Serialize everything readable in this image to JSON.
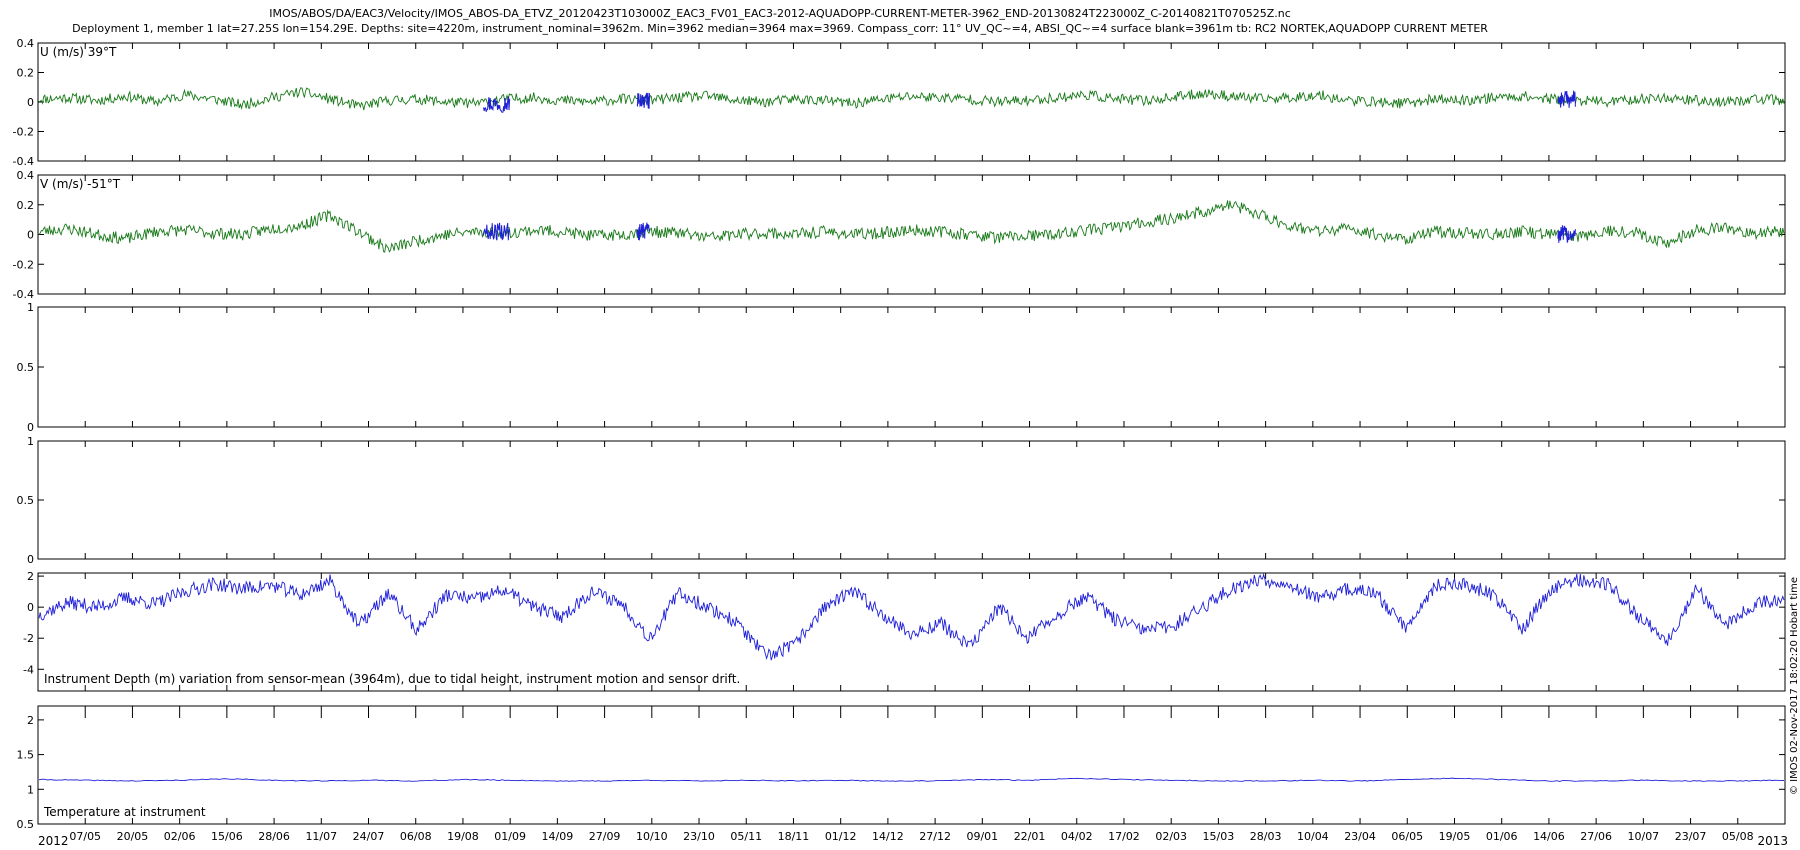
{
  "header": {
    "title_line1": "IMOS/ABOS/DA/EAC3/Velocity/IMOS_ABOS-DA_ETVZ_20120423T103000Z_EAC3_FV01_EAC3-2012-AQUADOPP-CURRENT-METER-3962_END-20130824T223000Z_C-20140821T070525Z.nc",
    "title_line2": "Deployment 1, member 1 lat=27.25S lon=154.29E. Depths: site=4220m, instrument_nominal=3962m. Min=3962 median=3964 max=3969. Compass_corr: 11° UV_QC~=4, ABSI_QC~=4 surface blank=3961m tb: RC2 NORTEK,AQUADOPP CURRENT METER"
  },
  "side_note": "© IMOS 02-Nov-2017 18:02:20 Hobart time",
  "time_axis": {
    "start_year_label": "2012",
    "end_year_label": "2013",
    "ticks": [
      "07/05",
      "20/05",
      "02/06",
      "15/06",
      "28/06",
      "11/07",
      "24/07",
      "06/08",
      "19/08",
      "01/09",
      "14/09",
      "27/09",
      "10/10",
      "23/10",
      "05/11",
      "18/11",
      "01/12",
      "14/12",
      "27/12",
      "09/01",
      "22/01",
      "04/02",
      "17/02",
      "02/03",
      "15/03",
      "28/03",
      "10/04",
      "23/04",
      "06/05",
      "19/05",
      "01/06",
      "14/06",
      "27/06",
      "10/07",
      "23/07",
      "05/08"
    ]
  },
  "colors": {
    "velocity_qc_good": "#1a7a1a",
    "velocity_qc_flagged": "#1f1fd8",
    "depth": "#1f1fd8",
    "temperature": "#1f1fd8",
    "axes": "#000000"
  },
  "chart_data": [
    {
      "id": "u",
      "type": "line",
      "title": "U (m/s) 39°T",
      "xlabel": "",
      "ylabel": "",
      "ylim": [
        -0.4,
        0.4
      ],
      "yticks": [
        "0.4",
        "0.2",
        "0",
        "-0.2",
        "-0.4"
      ],
      "yvals": [
        0.4,
        0.2,
        0,
        -0.2,
        -0.4
      ],
      "grid": false,
      "series": [
        {
          "values": [
            0.02,
            0.03,
            0.01,
            0.04,
            0.0,
            0.05,
            0.02,
            -0.02,
            0.03,
            0.07,
            0.02,
            -0.03,
            0.01,
            0.02,
            0.0,
            -0.01,
            0.02,
            0.03,
            0.01,
            0.0,
            0.02,
            0.01,
            0.03,
            0.04,
            0.01,
            0.0,
            0.02,
            0.01,
            -0.01,
            0.02,
            0.04,
            0.03,
            0.02,
            0.0,
            0.01,
            0.03,
            0.05,
            0.02,
            0.01,
            0.03,
            0.06,
            0.04,
            0.02,
            0.03,
            0.05,
            0.01,
            0.0,
            -0.01,
            0.02,
            0.01,
            0.03,
            0.04,
            0.02,
            0.01,
            0.0,
            0.02,
            0.03,
            0.01,
            0.0,
            0.02,
            0.01
          ]
        }
      ]
    },
    {
      "id": "v",
      "type": "line",
      "title": "V (m/s) -51°T",
      "xlabel": "",
      "ylabel": "",
      "ylim": [
        -0.4,
        0.4
      ],
      "yticks": [
        "0.4",
        "0.2",
        "0",
        "-0.2",
        "-0.4"
      ],
      "yvals": [
        0.4,
        0.2,
        0,
        -0.2,
        -0.4
      ],
      "grid": false,
      "series": [
        {
          "values": [
            0.02,
            0.04,
            0.0,
            -0.03,
            0.02,
            0.03,
            0.01,
            0.0,
            0.04,
            0.06,
            0.13,
            0.02,
            -0.1,
            -0.04,
            0.0,
            0.02,
            0.01,
            0.03,
            0.02,
            -0.01,
            0.0,
            0.02,
            0.01,
            -0.02,
            0.0,
            0.01,
            0.0,
            0.02,
            0.0,
            0.01,
            0.03,
            0.02,
            0.0,
            -0.02,
            -0.01,
            0.0,
            0.03,
            0.05,
            0.08,
            0.11,
            0.15,
            0.2,
            0.13,
            0.06,
            0.02,
            0.04,
            0.0,
            -0.03,
            0.02,
            0.01,
            0.0,
            0.02,
            0.0,
            -0.01,
            0.03,
            0.01,
            -0.06,
            0.03,
            0.04,
            0.01,
            0.02
          ]
        }
      ]
    },
    {
      "id": "empty1",
      "type": "line",
      "title": "",
      "xlabel": "",
      "ylabel": "",
      "ylim": [
        0,
        1
      ],
      "yticks": [
        "1",
        "0.5",
        "0"
      ],
      "yvals": [
        1,
        0.5,
        0
      ],
      "grid": false,
      "series": []
    },
    {
      "id": "empty2",
      "type": "line",
      "title": "",
      "xlabel": "",
      "ylabel": "",
      "ylim": [
        0,
        1
      ],
      "yticks": [
        "1",
        "0.5",
        "0"
      ],
      "yvals": [
        1,
        0.5,
        0
      ],
      "grid": false,
      "series": []
    },
    {
      "id": "depth",
      "type": "line",
      "title": "",
      "annotation": "Instrument Depth (m) variation from sensor-mean (3964m), due to tidal height, instrument motion and sensor drift.",
      "xlabel": "",
      "ylabel": "",
      "ylim": [
        -5.4,
        2.2
      ],
      "yticks": [
        "2",
        "0",
        "-2",
        "-4"
      ],
      "yvals": [
        2,
        0,
        -2,
        -4
      ],
      "grid": false,
      "series": [
        {
          "values": [
            -0.5,
            0.3,
            0.0,
            0.6,
            0.2,
            1.0,
            1.5,
            1.2,
            1.4,
            0.8,
            1.7,
            -1.2,
            0.9,
            -1.5,
            0.8,
            0.5,
            1.1,
            0.0,
            -0.6,
            1.0,
            0.3,
            -2.0,
            0.9,
            0.0,
            -1.0,
            -3.2,
            -2.4,
            0.0,
            1.0,
            -0.4,
            -1.8,
            -1.0,
            -2.6,
            0.0,
            -2.0,
            -0.5,
            0.7,
            -0.8,
            -1.5,
            -1.2,
            0.0,
            1.2,
            1.8,
            1.5,
            0.5,
            1.2,
            0.8,
            -1.3,
            1.4,
            1.5,
            0.8,
            -1.4,
            1.2,
            1.8,
            1.4,
            -0.6,
            -2.1,
            1.2,
            -1.1,
            0.2,
            0.6
          ]
        }
      ]
    },
    {
      "id": "temperature",
      "type": "line",
      "title": "",
      "annotation": "Temperature at instrument",
      "xlabel": "",
      "ylabel": "",
      "ylim": [
        0.5,
        2.2
      ],
      "yticks": [
        "2",
        "1.5",
        "1",
        "0.5"
      ],
      "yvals": [
        2,
        1.5,
        1,
        0.5
      ],
      "grid": false,
      "series": [
        {
          "values": [
            1.14,
            1.13,
            1.12,
            1.13,
            1.15,
            1.13,
            1.12,
            1.13,
            1.12,
            1.14,
            1.13,
            1.12,
            1.12,
            1.13,
            1.12,
            1.13,
            1.12,
            1.13,
            1.12,
            1.12,
            1.14,
            1.13,
            1.16,
            1.14,
            1.13,
            1.12,
            1.12,
            1.13,
            1.12,
            1.14,
            1.16,
            1.14,
            1.12,
            1.12,
            1.13,
            1.12,
            1.12,
            1.13
          ]
        }
      ]
    }
  ]
}
